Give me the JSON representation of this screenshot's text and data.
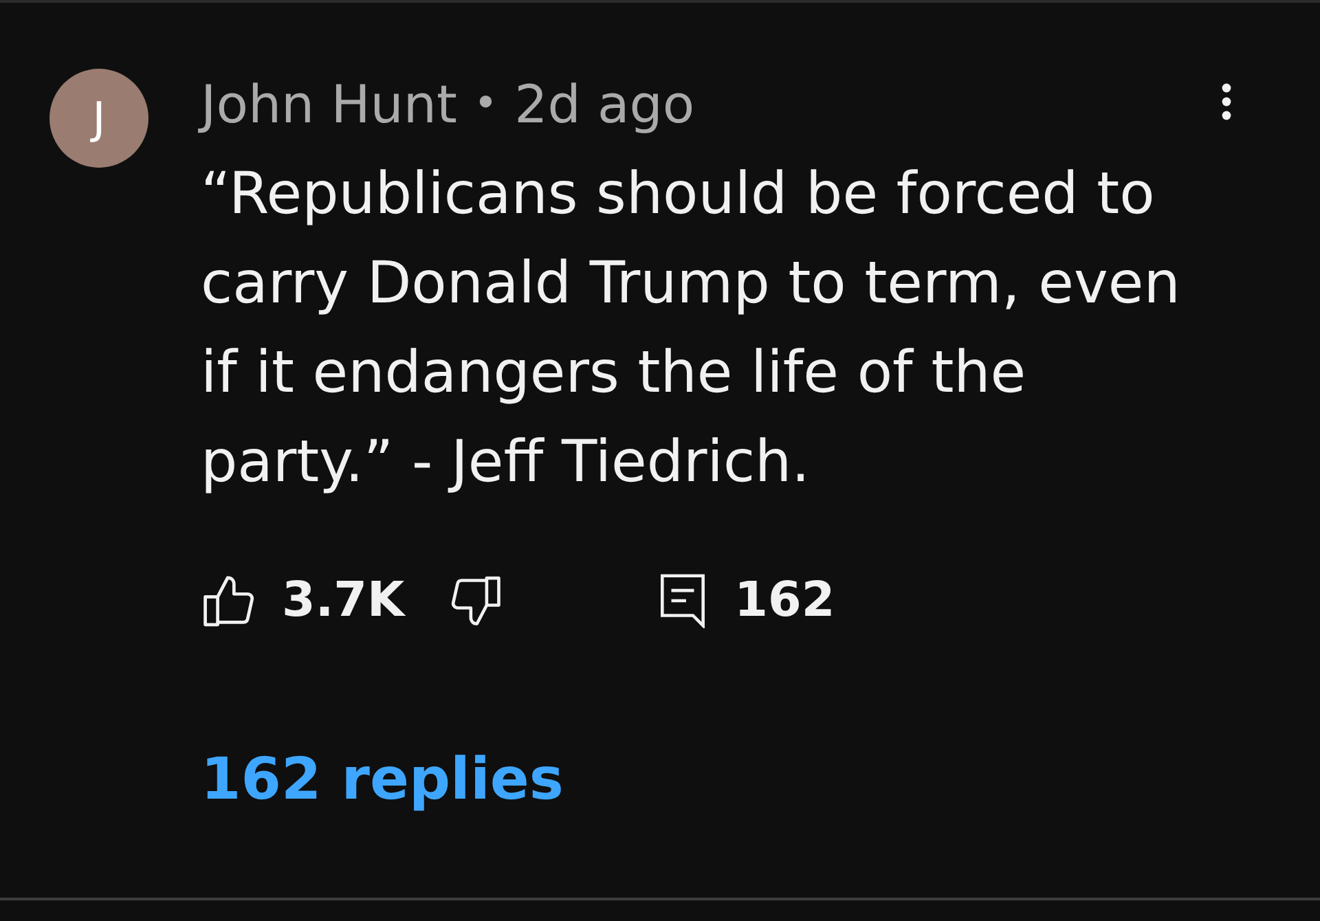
{
  "comment": {
    "avatar": {
      "initial": "J"
    },
    "author": "John Hunt",
    "separator": "•",
    "time": "2d ago",
    "text": "“Republicans should be forced to carry Donald Trump to term, even if it endangers the life of the party.” - Jeff Tiedrich."
  },
  "actions": {
    "likes": "3.7K",
    "reply_count": "162"
  },
  "replies_link": "162 replies"
}
